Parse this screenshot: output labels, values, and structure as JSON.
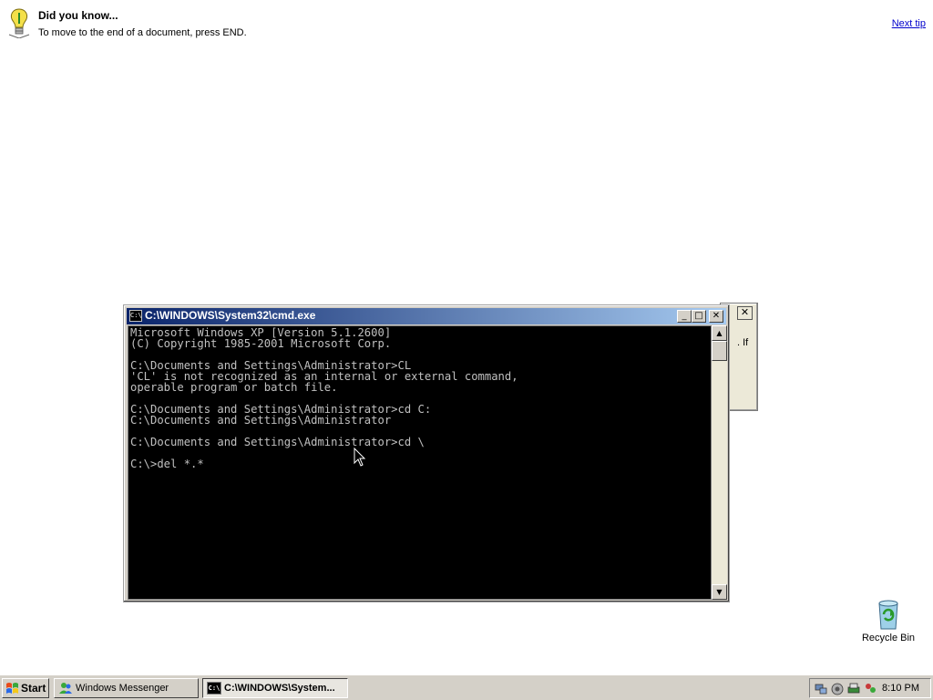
{
  "tip": {
    "title": "Did you know...",
    "text": "To move to the end of a document, press END.",
    "next_label": "Next tip"
  },
  "background_dialog": {
    "close_label": "✕",
    "fragment": ". If"
  },
  "cmd_window": {
    "title": "C:\\WINDOWS\\System32\\cmd.exe",
    "icon_text": "C:\\",
    "min_label": "_",
    "max_label": "□",
    "close_label": "✕",
    "lines": [
      "Microsoft Windows XP [Version 5.1.2600]",
      "(C) Copyright 1985-2001 Microsoft Corp.",
      "",
      "C:\\Documents and Settings\\Administrator>CL",
      "'CL' is not recognized as an internal or external command,",
      "operable program or batch file.",
      "",
      "C:\\Documents and Settings\\Administrator>cd C:",
      "C:\\Documents and Settings\\Administrator",
      "",
      "C:\\Documents and Settings\\Administrator>cd \\",
      "",
      "C:\\>del *.*"
    ],
    "scroll_up": "▲",
    "scroll_down": "▼"
  },
  "desktop": {
    "recycle_bin_label": "Recycle Bin"
  },
  "taskbar": {
    "start_label": "Start",
    "tasks": [
      {
        "label": "Windows Messenger",
        "icon": "messenger-icon"
      },
      {
        "label": "C:\\WINDOWS\\System...",
        "icon": "cmd-icon",
        "icon_text": "C:\\"
      }
    ],
    "tray_icons": [
      "network-icon",
      "volume-icon",
      "printer-icon",
      "people-icon"
    ],
    "clock": "8:10 PM"
  },
  "colors": {
    "titlebar_start": "#0a246a",
    "titlebar_end": "#a6caf0",
    "console_bg": "#000000",
    "console_text": "#c0c0c0",
    "link": "#0000cc"
  }
}
